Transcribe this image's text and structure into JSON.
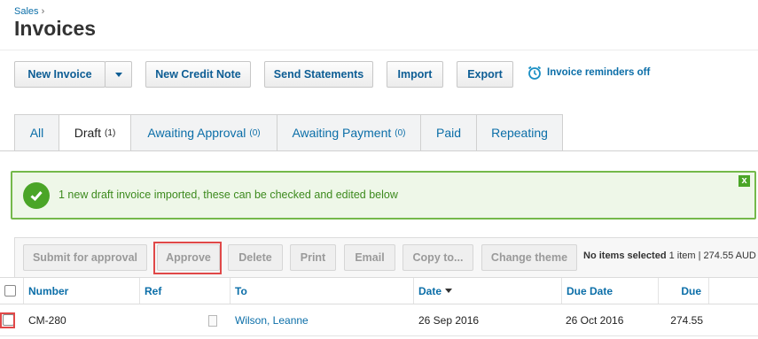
{
  "breadcrumb": {
    "parent": "Sales",
    "separator": "›"
  },
  "page": {
    "title": "Invoices"
  },
  "toolbar": {
    "new_invoice": "New Invoice",
    "new_credit_note": "New Credit Note",
    "send_statements": "Send Statements",
    "import": "Import",
    "export": "Export",
    "reminders": "Invoice reminders off"
  },
  "tabs": [
    {
      "label": "All",
      "count": ""
    },
    {
      "label": "Draft",
      "count": "(1)"
    },
    {
      "label": "Awaiting Approval",
      "count": "(0)"
    },
    {
      "label": "Awaiting Payment",
      "count": "(0)"
    },
    {
      "label": "Paid",
      "count": ""
    },
    {
      "label": "Repeating",
      "count": ""
    }
  ],
  "active_tab": "Draft",
  "alert": {
    "message": "1 new draft invoice imported, these can be checked and edited below",
    "close": "x"
  },
  "actions": {
    "submit_for_approval": "Submit for approval",
    "approve": "Approve",
    "delete": "Delete",
    "print": "Print",
    "email": "Email",
    "copy_to": "Copy to...",
    "change_theme": "Change theme"
  },
  "selection": {
    "none_selected": "No items selected",
    "item_count": "1 item",
    "total": "| 274.55",
    "currency": "AUD"
  },
  "table": {
    "columns": [
      "Number",
      "Ref",
      "To",
      "Date",
      "Due Date",
      "Due"
    ],
    "sorted_by": "Date",
    "rows": [
      {
        "number": "CM-280",
        "ref": "",
        "to": "Wilson, Leanne",
        "date": "26 Sep 2016",
        "due_date": "26 Oct 2016",
        "due": "274.55"
      }
    ]
  },
  "colors": {
    "link": "#0b6ea8",
    "success": "#4aa527",
    "highlight": "#e04848"
  },
  "icons": [
    "alarm-clock-icon",
    "check-circle-icon",
    "chevron-down-icon",
    "sort-desc-icon",
    "document-icon",
    "close-icon"
  ]
}
